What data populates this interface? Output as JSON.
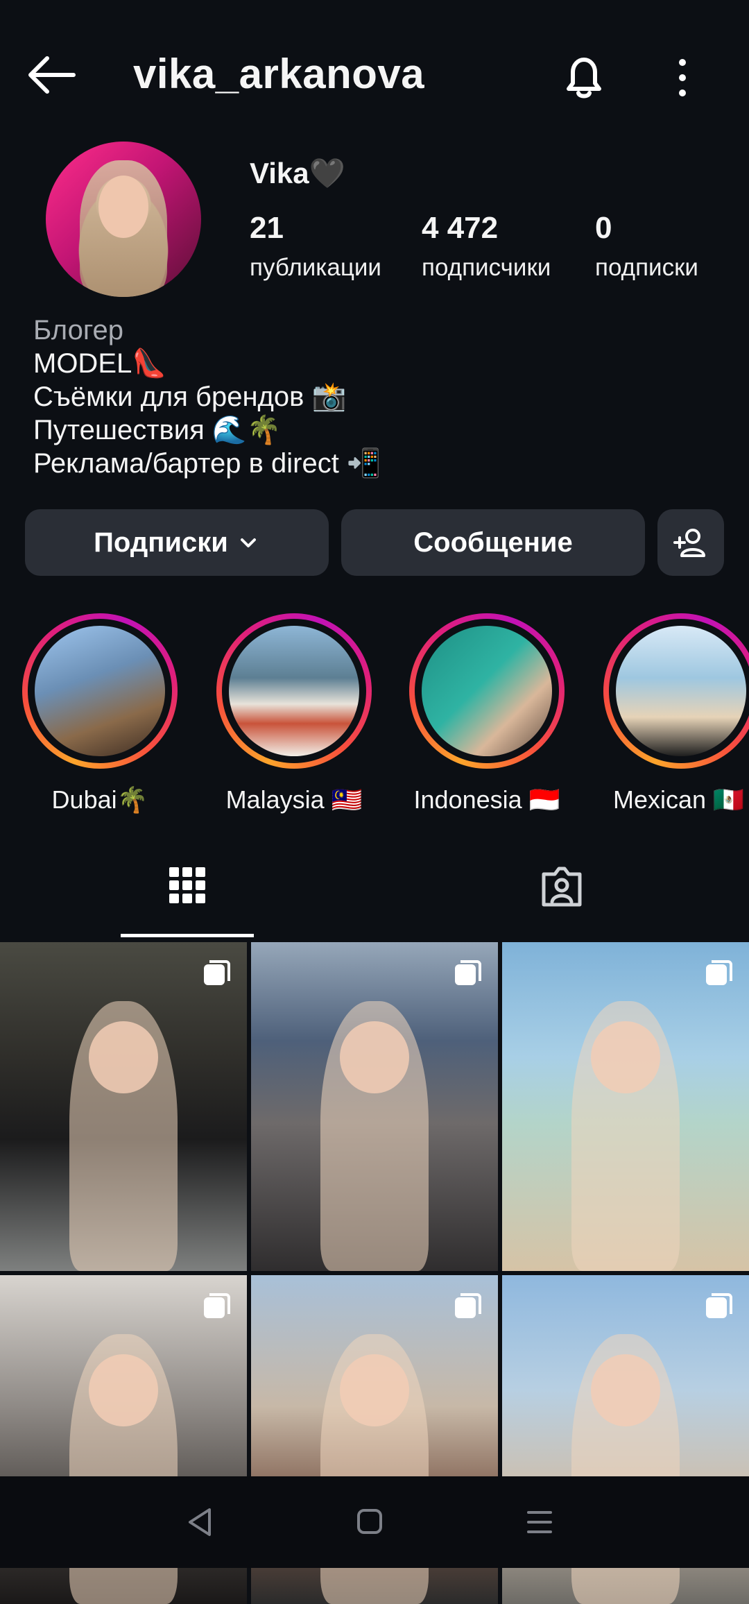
{
  "header": {
    "username": "vika_arkanova",
    "icons": [
      "back-arrow-icon",
      "bell-icon",
      "more-vertical-icon"
    ]
  },
  "profile": {
    "display_name": "Vika🖤",
    "stats": {
      "posts": {
        "value": "21",
        "label": "публикации"
      },
      "followers": {
        "value": "4 472",
        "label": "подписчики"
      },
      "following": {
        "value": "0",
        "label": "подписки"
      }
    },
    "bio": {
      "category": "Блогер",
      "lines": [
        "MODEL👠",
        "Съёмки для брендов 📸",
        "Путешествия 🌊🌴",
        "Реклама/бартер в direct 📲"
      ]
    }
  },
  "actions": {
    "follow_label": "Подписки",
    "message_label": "Сообщение"
  },
  "highlights": [
    {
      "label": "Dubai🌴"
    },
    {
      "label": "Malaysia 🇲🇾"
    },
    {
      "label": "Indonesia 🇮🇩"
    },
    {
      "label": "Mexican 🇲🇽"
    }
  ],
  "tabs": [
    "grid-icon",
    "tagged-icon"
  ],
  "colors": {
    "background": "#0c0f14",
    "button": "#2a2e36",
    "story_ring": [
      "#fca42b",
      "#f8503c",
      "#e01f7a",
      "#c212b6"
    ]
  },
  "posts_count_visible": 6,
  "navbar": [
    "nav-back-icon",
    "nav-home-icon",
    "nav-recents-icon"
  ]
}
